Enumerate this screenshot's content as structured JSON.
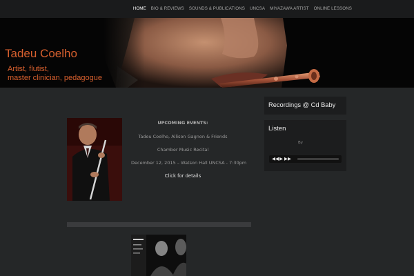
{
  "nav": {
    "items": [
      "HOME",
      "BIO & REVIEWS",
      "SOUNDS & PUBLICATIONS",
      "UNCSA",
      "MIYAZAWA ARTIST",
      "ONLINE LESSONS"
    ]
  },
  "header": {
    "title": "Tadeu Coelho",
    "tagline_line1": "Artist, flutist,",
    "tagline_line2": "master clinician, pedagogue"
  },
  "events": {
    "heading": "UPCOMING EVENTS:",
    "performers": "Tadeu Coelho, Allison Gagnon & Friends",
    "name": "Chamber Music Recital",
    "date_place": "December 12, 2015 – Watson Hall UNCSA - 7:30pm",
    "details_link": "Click for details"
  },
  "sidebar": {
    "recordings_link": "Recordings @ Cd Baby",
    "listen_title": "Listen",
    "by_text": "By"
  },
  "player": {
    "prev_icon": "◀◀",
    "play_icon": "▶",
    "next_icon": "▶▶"
  },
  "colors": {
    "accent": "#d8602e",
    "background": "#252728",
    "topbar": "#1a1b1c",
    "widget": "#1c1d1e"
  }
}
